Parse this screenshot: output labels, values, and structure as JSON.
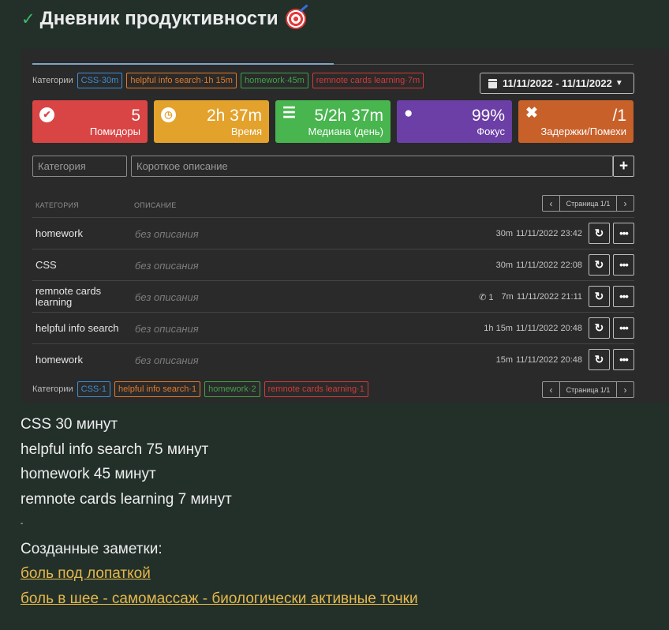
{
  "title": {
    "text": "Дневник продуктивности",
    "check_icon": "checkmark-icon",
    "emoji_icon": "target-icon"
  },
  "colors": {
    "bg": "#23302a",
    "panel": "#2a2a2a",
    "link": "#e6b84a"
  },
  "panel": {
    "categories_label": "Категории",
    "top_chips": [
      {
        "text": "CSS·30m",
        "color": "#3b8fd6"
      },
      {
        "text": "helpful info search·1h 15m",
        "color": "#e07a2a"
      },
      {
        "text": "homework·45m",
        "color": "#3fa34a"
      },
      {
        "text": "remnote cards learning·7m",
        "color": "#d33a3a"
      }
    ],
    "date_range": "11/11/2022 - 11/11/2022",
    "stats": [
      {
        "value": "5",
        "label": "Помидоры",
        "color": "#d94545",
        "icon": "check-circle-icon"
      },
      {
        "value": "2h 37m",
        "label": "Время",
        "color": "#e3a22c",
        "icon": "clock-icon"
      },
      {
        "value": "5/2h 37m",
        "label": "Медиана (день)",
        "color": "#48b54f",
        "icon": "list-icon"
      },
      {
        "value": "99%",
        "label": "Фокус",
        "color": "#6b3fa6",
        "icon": "lightbulb-icon"
      },
      {
        "value": "/1",
        "label": "Задержки/Помехи",
        "color": "#c8602a",
        "icon": "x-icon"
      }
    ],
    "category_placeholder": "Категория",
    "description_placeholder": "Короткое описание",
    "col_category": "КАТЕГОРИЯ",
    "col_description": "ОПИСАНИЕ",
    "pager_text": "Страница 1/1",
    "rows": [
      {
        "category": "homework",
        "description": "без описания",
        "interruptions": "",
        "duration": "30m",
        "datetime": "11/11/2022 23:42"
      },
      {
        "category": "CSS",
        "description": "без описания",
        "interruptions": "",
        "duration": "30m",
        "datetime": "11/11/2022 22:08"
      },
      {
        "category": "remnote cards learning",
        "description": "без описания",
        "interruptions": "1",
        "duration": "7m",
        "datetime": "11/11/2022 21:11"
      },
      {
        "category": "helpful info search",
        "description": "без описания",
        "interruptions": "",
        "duration": "1h 15m",
        "datetime": "11/11/2022 20:48"
      },
      {
        "category": "homework",
        "description": "без описания",
        "interruptions": "",
        "duration": "15m",
        "datetime": "11/11/2022 20:48"
      }
    ],
    "bottom_chips": [
      {
        "text": "CSS·1",
        "color": "#3b8fd6"
      },
      {
        "text": "helpful info search·1",
        "color": "#e07a2a"
      },
      {
        "text": "homework·2",
        "color": "#3fa34a"
      },
      {
        "text": "remnote cards learning·1",
        "color": "#d33a3a"
      }
    ]
  },
  "notes": {
    "lines": [
      "CSS 30 минут",
      "helpful info search 75 минут",
      "homework 45 минут",
      "remnote cards learning 7 минут",
      "-",
      "Созданные заметки:"
    ],
    "links": [
      "боль под лопаткой",
      "боль в шее - самомассаж - биологически активные точки"
    ]
  }
}
